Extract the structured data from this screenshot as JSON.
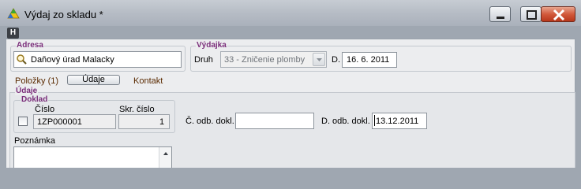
{
  "window": {
    "title": "Výdaj zo skladu *",
    "icons": {
      "app": "app-icon",
      "minimize": "minimize-icon",
      "maximize": "maximize-icon",
      "close": "close-icon"
    }
  },
  "badge": "H",
  "adresa": {
    "legend": "Adresa",
    "value": "Daňový úrad Malacky",
    "icon": "search-icon"
  },
  "vydajka": {
    "legend": "Výdajka",
    "druh_label": "Druh",
    "druh_value": "33 - Zničenie plomby",
    "d_label": "D.",
    "d_value": "16. 6. 2011"
  },
  "tabs": {
    "polozky": "Položky (1)",
    "udaje": "Údaje",
    "kontakt": "Kontakt"
  },
  "udaje": {
    "legend": "Údaje",
    "doklad": {
      "legend": "Doklad",
      "cislo_label": "Číslo",
      "cislo_value": "1ZP000001",
      "skr_label": "Skr. číslo",
      "skr_value": "1"
    },
    "c_odb_label": "Č. odb. dokl.",
    "c_odb_value": "",
    "d_odb_label": "D. odb. dokl.",
    "d_odb_value": "13.12.2011",
    "poznamka_label": "Poznámka",
    "poznamka_value": ""
  }
}
